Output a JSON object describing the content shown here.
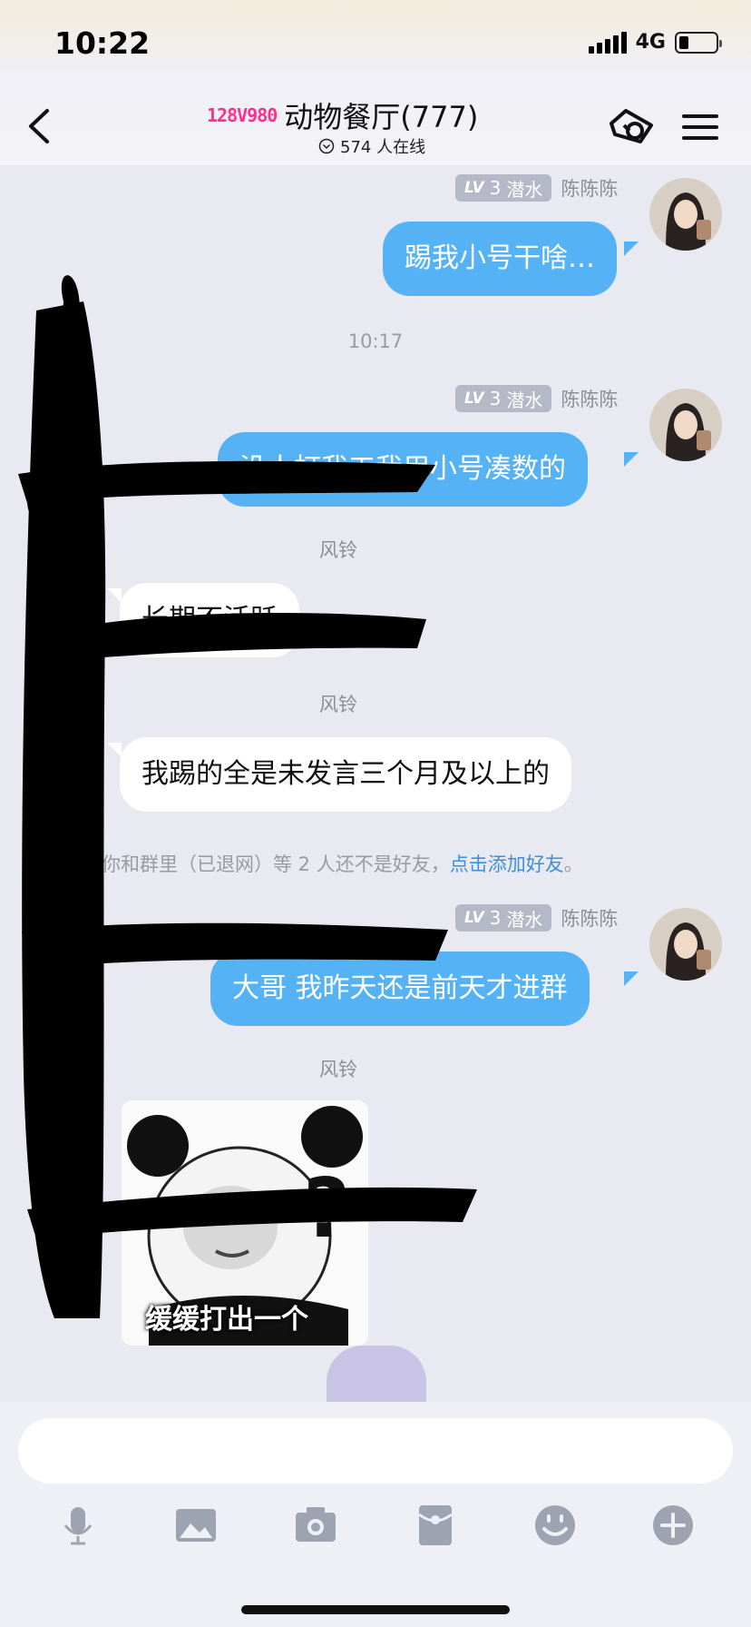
{
  "status": {
    "time": "10:22",
    "network": "4G"
  },
  "header": {
    "group_badge": "128V980",
    "title": "动物餐厅(777)",
    "online": "574 人在线"
  },
  "messages": {
    "m1": {
      "level": "LV",
      "level_num": "3",
      "rank": "潜水",
      "name": "陈陈陈",
      "text": "踢我小号干啥…"
    },
    "time": "10:17",
    "m2": {
      "level": "LV",
      "level_num": "3",
      "rank": "潜水",
      "name": "陈陈陈",
      "text": "没人打我工我用小号凑数的"
    },
    "m3": {
      "name": "风铃",
      "text": "长期不活跃"
    },
    "m4": {
      "name": "风铃",
      "text": "我踢的全是未发言三个月及以上的"
    },
    "notice": {
      "text": "你和群里（已退网）等 2 人还不是好友，",
      "link": "点击添加好友",
      "end": "。"
    },
    "m5": {
      "level": "LV",
      "level_num": "3",
      "rank": "潜水",
      "name": "陈陈陈",
      "text": "大哥 我昨天还是前天才进群"
    },
    "m6": {
      "name": "风铃",
      "sticker_caption": "缓缓打出一个"
    }
  },
  "colors": {
    "outgoing_bubble": "#54b2f5",
    "incoming_bubble": "#ffffff",
    "link": "#3d8fe0",
    "background": "#e9e9f1"
  },
  "toolbar": [
    "mic-icon",
    "image-icon",
    "camera-icon",
    "red-packet-icon",
    "emoji-icon",
    "plus-icon"
  ]
}
